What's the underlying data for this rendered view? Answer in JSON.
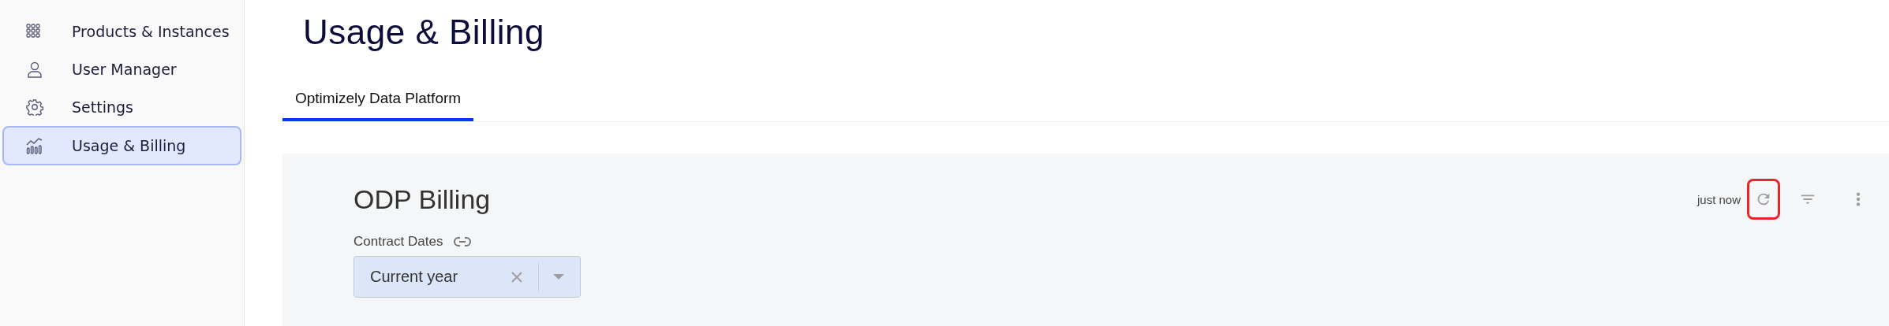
{
  "sidebar": {
    "items": [
      {
        "label": "Products & Instances",
        "selected": false
      },
      {
        "label": "User Manager",
        "selected": false
      },
      {
        "label": "Settings",
        "selected": false
      },
      {
        "label": "Usage & Billing",
        "selected": true
      }
    ]
  },
  "page_title": "Usage & Billing",
  "tabs": [
    {
      "label": "Optimizely Data Platform",
      "selected": true
    }
  ],
  "dashboard": {
    "title": "ODP Billing",
    "updated": "just now",
    "refresh_highlighted": true,
    "filter": {
      "label": "Contract Dates",
      "value": "Current year"
    }
  }
}
